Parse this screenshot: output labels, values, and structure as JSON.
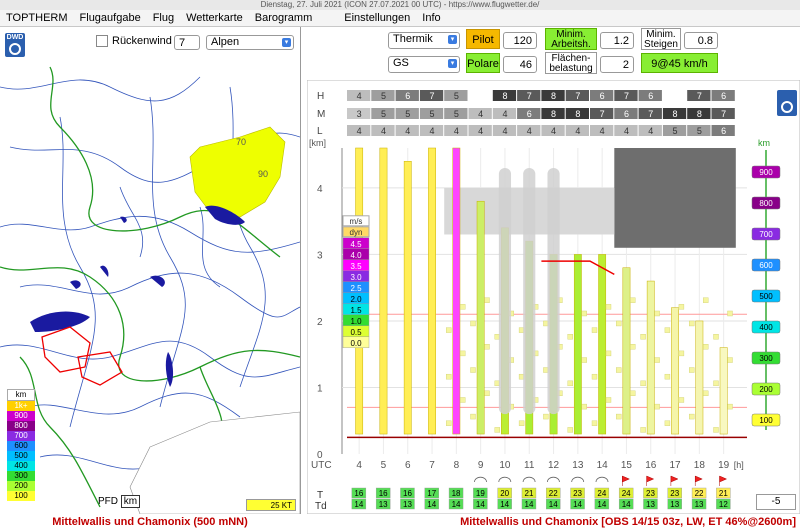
{
  "window": {
    "title": "Dienstag, 27. Juli 2021  (ICON 27.07.2021 00 UTC) - https://www.flugwetter.de/"
  },
  "menu": [
    "TOPTHERM",
    "Flugaufgabe",
    "Flug",
    "Wetterkarte",
    "Barogramm",
    "Einstellungen",
    "Info"
  ],
  "map": {
    "dwd_label": "DWD",
    "rueckenwind_label": "Rückenwind",
    "wind_value": "7",
    "region": "Alpen",
    "contour_labels": [
      "70",
      "90"
    ],
    "legend_unit": "km",
    "legend": [
      {
        "label": "1k+",
        "color": "#ffd000"
      },
      {
        "label": "900",
        "color": "#cc00cc"
      },
      {
        "label": "800",
        "color": "#880088"
      },
      {
        "label": "700",
        "color": "#8a2be2"
      },
      {
        "label": "600",
        "color": "#1e90ff"
      },
      {
        "label": "500",
        "color": "#00bfff"
      },
      {
        "label": "400",
        "color": "#00e5e5"
      },
      {
        "label": "300",
        "color": "#33dd33"
      },
      {
        "label": "200",
        "color": "#aaff33"
      },
      {
        "label": "100",
        "color": "#ffff33"
      }
    ],
    "pfd_label": "PFD",
    "pfd_unit": "km",
    "wind_scale": "25 KT"
  },
  "controls": {
    "mode": "Thermik",
    "glider": "GS",
    "pilot_label": "Pilot",
    "pilot_value": "120",
    "polare_label": "Polare",
    "polare_value": "46",
    "min_arbeit_label1": "Minim.",
    "min_arbeit_label2": "Arbeitsh.",
    "min_arbeit_value": "1.2",
    "flaechen_label1": "Flächen-",
    "flaechen_label2": "belastung",
    "flaechen_value": "2",
    "min_steigen_label1": "Minim.",
    "min_steigen_label2": "Steigen",
    "min_steigen_value": "0.8",
    "result": "9@45 km/h"
  },
  "chart_data": {
    "type": "heatmap",
    "cloud_rows": [
      {
        "label": "H",
        "values": [
          "4",
          "5",
          "6",
          "7",
          "5",
          "",
          "8",
          "7",
          "8",
          "7",
          "6",
          "7",
          "6",
          "",
          "7",
          "6"
        ]
      },
      {
        "label": "M",
        "values": [
          "3",
          "5",
          "5",
          "5",
          "5",
          "4",
          "4",
          "6",
          "8",
          "8",
          "7",
          "6",
          "7",
          "8",
          "8",
          "7"
        ]
      },
      {
        "label": "L",
        "values": [
          "4",
          "4",
          "4",
          "4",
          "4",
          "4",
          "4",
          "4",
          "4",
          "4",
          "4",
          "4",
          "4",
          "5",
          "5",
          "6"
        ]
      }
    ],
    "y_unit": "[km]",
    "y_ticks": [
      "1",
      "2",
      "3",
      "4"
    ],
    "y_zero": "0",
    "x_label": "UTC",
    "x_ticks": [
      "4",
      "5",
      "6",
      "7",
      "8",
      "9",
      "10",
      "11",
      "12",
      "13",
      "14",
      "15",
      "16",
      "17",
      "18",
      "19"
    ],
    "x_unit": "[h]",
    "climb_legend_unit": "m/s",
    "climb_legend_dyn": "dyn",
    "climb_legend": [
      {
        "label": "4.5",
        "color": "#cc00cc"
      },
      {
        "label": "4.0",
        "color": "#aa00aa"
      },
      {
        "label": "3.5",
        "color": "#ff00ff"
      },
      {
        "label": "3.0",
        "color": "#8a2be2"
      },
      {
        "label": "2.5",
        "color": "#1e90ff"
      },
      {
        "label": "2.0",
        "color": "#00bfff"
      },
      {
        "label": "1.5",
        "color": "#00e5e5"
      },
      {
        "label": "1.0",
        "color": "#33dd33"
      },
      {
        "label": "0.5",
        "color": "#ddff33"
      },
      {
        "label": "0.0",
        "color": "#ffff99"
      }
    ],
    "right_scale_unit": "km",
    "right_scale": [
      {
        "label": "900",
        "color": "#aa00aa"
      },
      {
        "label": "800",
        "color": "#880088"
      },
      {
        "label": "700",
        "color": "#8a2be2"
      },
      {
        "label": "600",
        "color": "#1e90ff"
      },
      {
        "label": "500",
        "color": "#00bfff"
      },
      {
        "label": "400",
        "color": "#00e5e5"
      },
      {
        "label": "300",
        "color": "#33dd33"
      },
      {
        "label": "200",
        "color": "#aaff33"
      },
      {
        "label": "100",
        "color": "#ffff33"
      }
    ],
    "T_label": "T",
    "Td_label": "Td",
    "T": [
      "16",
      "16",
      "16",
      "17",
      "18",
      "19",
      "20",
      "21",
      "22",
      "23",
      "24",
      "24",
      "23",
      "23",
      "22",
      "21"
    ],
    "Td": [
      "14",
      "13",
      "13",
      "14",
      "14",
      "14",
      "14",
      "14",
      "14",
      "14",
      "14",
      "14",
      "13",
      "13",
      "13",
      "12"
    ],
    "offset_value": "-5"
  },
  "footer": {
    "left": "Mittelwallis und Chamonix (500 mNN)",
    "right": "Mittelwallis und Chamonix [OBS 14/15 03z, LW, ET  46%@2600m]"
  }
}
